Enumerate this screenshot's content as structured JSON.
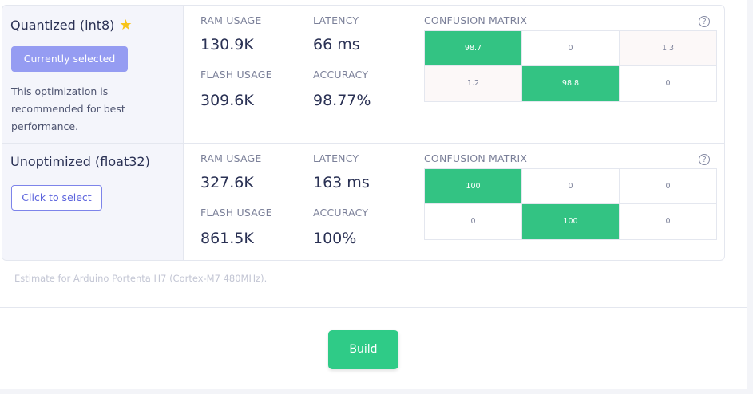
{
  "optimizations": [
    {
      "title": "Quantized (int8)",
      "button_label": "Currently selected",
      "description": "This optimization is recommended for best performance.",
      "ram_label": "RAM USAGE",
      "ram_value": "130.9K",
      "latency_label": "LATENCY",
      "latency_value": "66 ms",
      "flash_label": "FLASH USAGE",
      "flash_value": "309.6K",
      "accuracy_label": "ACCURACY",
      "accuracy_value": "98.77%",
      "matrix_label": "CONFUSION MATRIX",
      "matrix": [
        [
          "98.7",
          "0",
          "1.3"
        ],
        [
          "1.2",
          "98.8",
          "0"
        ]
      ]
    },
    {
      "title": "Unoptimized (float32)",
      "button_label": "Click to select",
      "ram_label": "RAM USAGE",
      "ram_value": "327.6K",
      "latency_label": "LATENCY",
      "latency_value": "163 ms",
      "flash_label": "FLASH USAGE",
      "flash_value": "861.5K",
      "accuracy_label": "ACCURACY",
      "accuracy_value": "100%",
      "matrix_label": "CONFUSION MATRIX",
      "matrix": [
        [
          "100",
          "0",
          "0"
        ],
        [
          "0",
          "100",
          "0"
        ]
      ]
    }
  ],
  "footnote": "Estimate for Arduino Portenta H7 (Cortex-M7 480MHz).",
  "build_label": "Build",
  "icons": {
    "star": "star-icon",
    "help": "help-icon"
  },
  "colors": {
    "accent_green": "#33c383",
    "selected_button": "#959cf2",
    "select_border": "#7d84ea"
  }
}
